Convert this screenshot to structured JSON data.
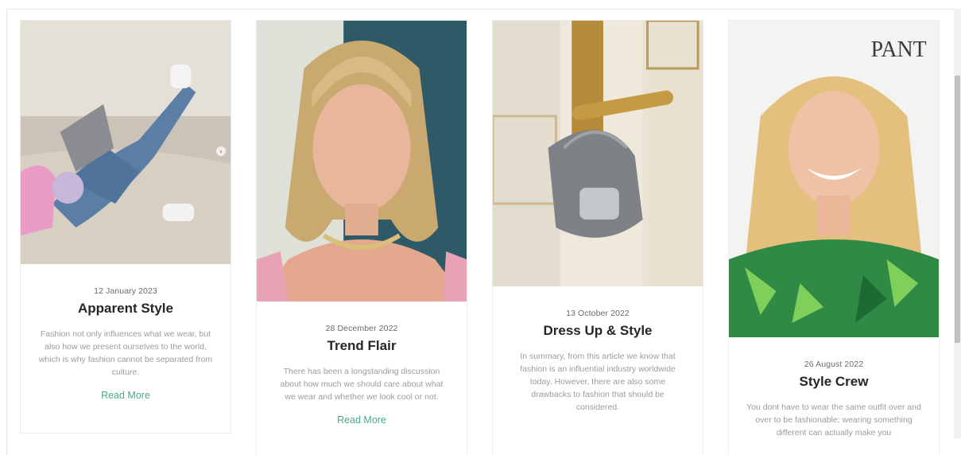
{
  "posts": [
    {
      "date": "12 January 2023",
      "title": "Apparent Style",
      "excerpt": "Fashion not only influences what we wear, but also how we present ourselves to the world, which is why fashion cannot be separated from culture.",
      "read_more": "Read More",
      "image_desc": "woman-with-laptop-on-sofa"
    },
    {
      "date": "28 December 2022",
      "title": "Trend Flair",
      "excerpt": "There has been a longstanding discussion about how much we should care about what we wear and whether we look cool or not.",
      "read_more": "Read More",
      "image_desc": "blonde-woman-portrait"
    },
    {
      "date": "13 October 2022",
      "title": "Dress Up & Style",
      "excerpt": "In summary, from this article we know that fashion is an influential industry worldwide today. However, there are also some drawbacks to fashion that should be considered.",
      "read_more": "",
      "image_desc": "silver-handbag-on-door-handle"
    },
    {
      "date": "26 August 2022",
      "title": "Style Crew",
      "excerpt": "You dont have to wear the same outfit over and over to be fashionable; wearing something different can actually make you",
      "read_more": "",
      "image_desc": "smiling-blonde-woman-green-dress",
      "backdrop_text": "PANT"
    }
  ],
  "colors": {
    "accent": "#4aa891",
    "title": "#262626",
    "excerpt": "#9c9c9c"
  }
}
